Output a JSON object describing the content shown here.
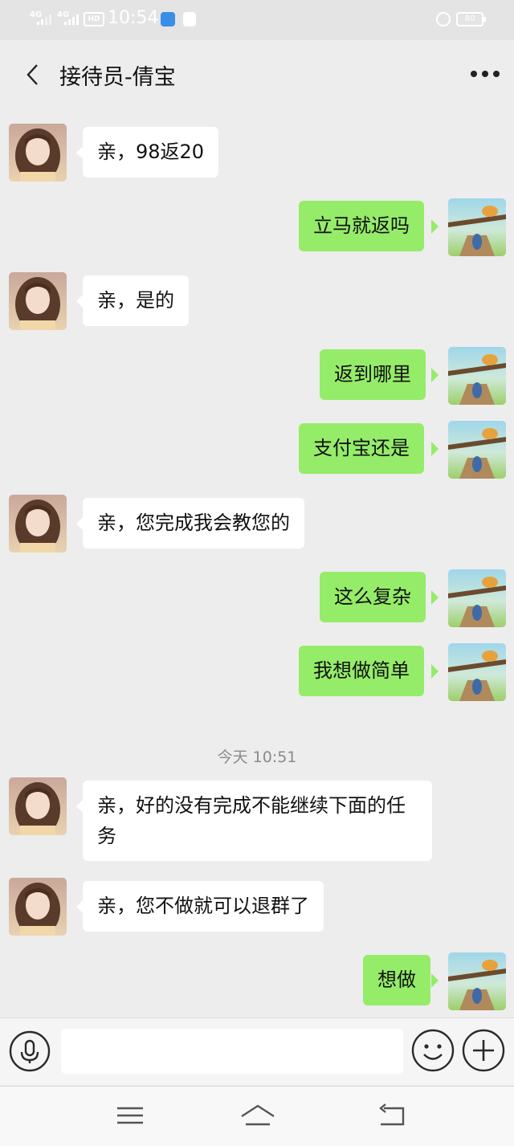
{
  "status_bar": {
    "signal1": "4G",
    "signal2": "4G",
    "hd": "HD",
    "time": "10:54",
    "battery": "80"
  },
  "header": {
    "title": "接待员-倩宝",
    "back_icon": "chevron-left-icon",
    "more_icon": "more-dots-icon"
  },
  "messages": [
    {
      "from": "agent",
      "text": "亲，98返20"
    },
    {
      "from": "me",
      "text": "立马就返吗"
    },
    {
      "from": "agent",
      "text": "亲，是的"
    },
    {
      "from": "me",
      "text": "返到哪里"
    },
    {
      "from": "me",
      "text": "支付宝还是"
    },
    {
      "from": "agent",
      "text": "亲，您完成我会教您的"
    },
    {
      "from": "me",
      "text": "这么复杂"
    },
    {
      "from": "me",
      "text": "我想做简单"
    },
    {
      "from": "agent",
      "text": "亲，好的没有完成不能继续下面的任务"
    },
    {
      "from": "agent",
      "text": "亲，您不做就可以退群了"
    },
    {
      "from": "me",
      "text": "想做"
    }
  ],
  "timestamp": "今天 10:51",
  "input_bar": {
    "placeholder": "",
    "voice_icon": "microphone-icon",
    "emoji_icon": "smiley-icon",
    "plus_icon": "plus-icon"
  },
  "nav_bar": {
    "menu_icon": "menu-icon",
    "home_icon": "home-icon",
    "back_icon": "back-icon"
  },
  "colors": {
    "sent_bubble": "#95ec69",
    "received_bubble": "#ffffff",
    "background": "#ededed"
  }
}
